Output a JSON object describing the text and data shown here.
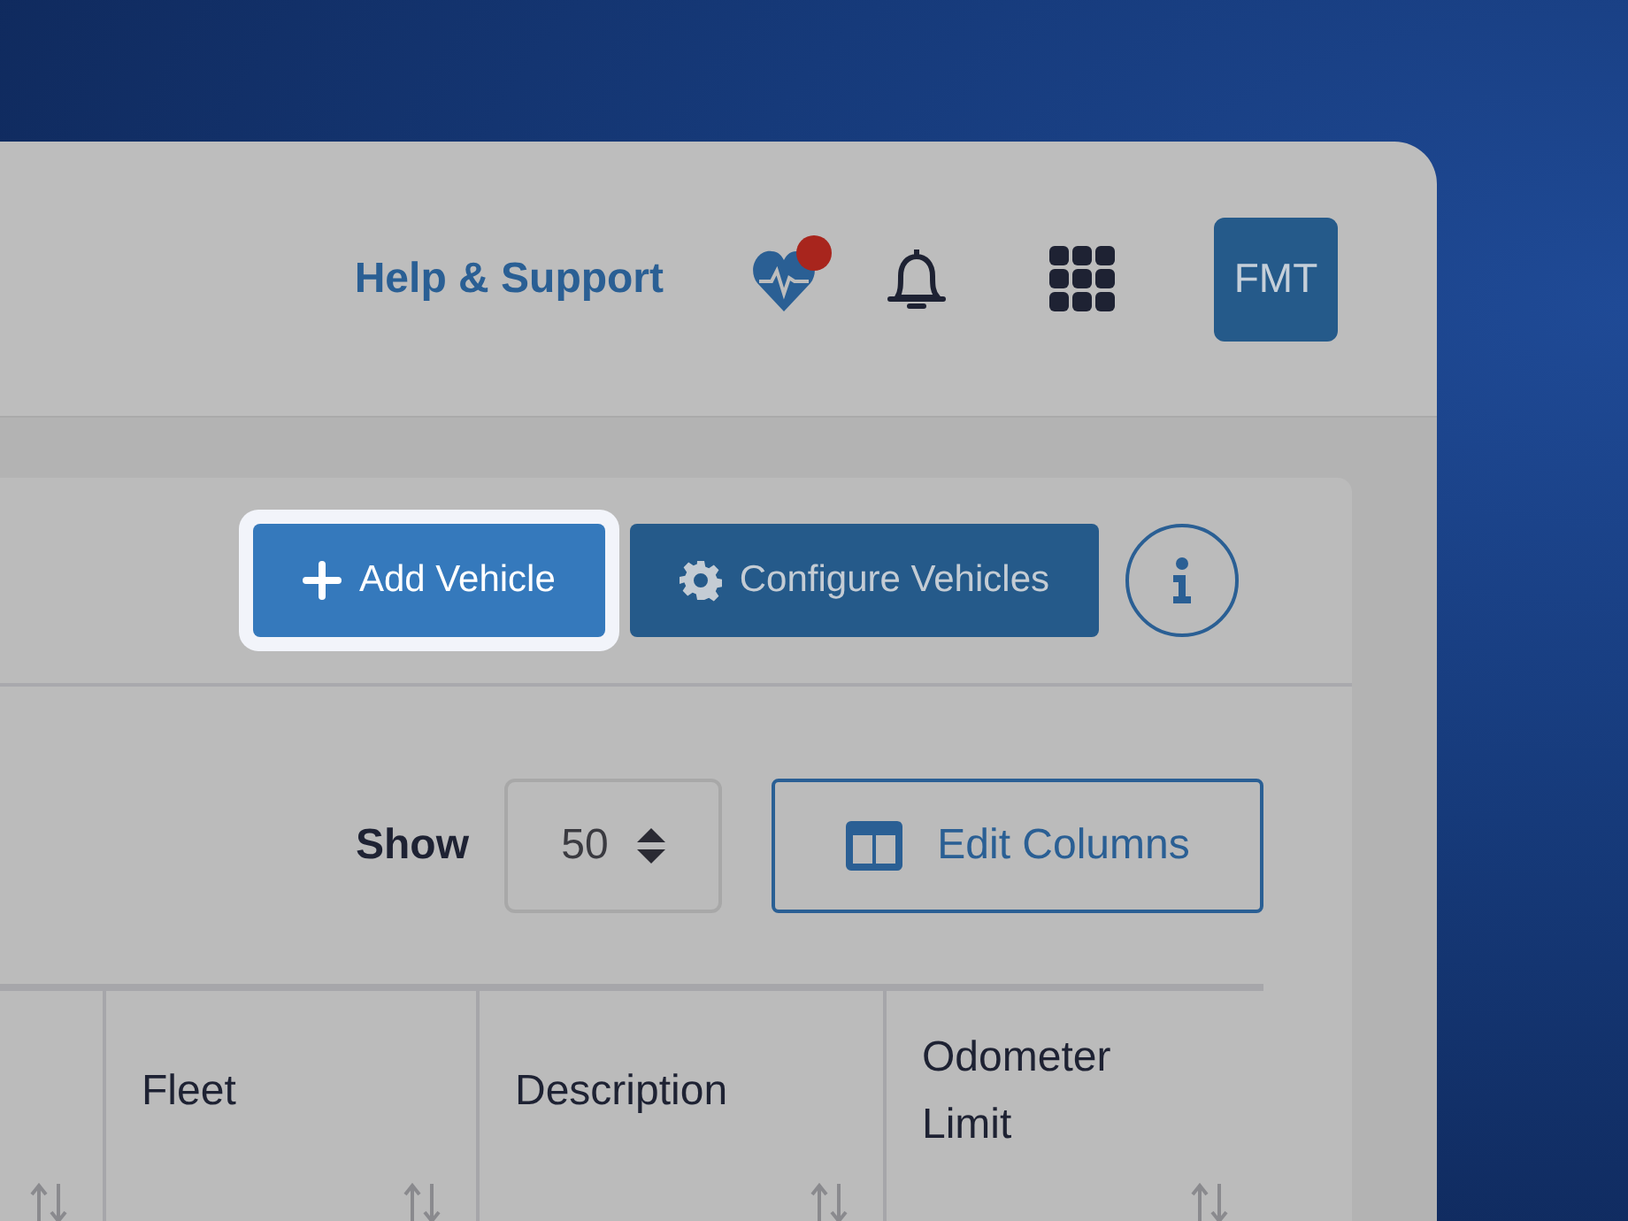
{
  "header": {
    "help_link": "Help & Support",
    "health": {
      "alert": true
    },
    "avatar": {
      "initials": "FMT"
    }
  },
  "toolbar": {
    "buttons": [
      {
        "label": "Add Vehicle",
        "kind": "add",
        "highlighted": true
      },
      {
        "label": "Configure Vehicles",
        "kind": "configure",
        "highlighted": false
      }
    ]
  },
  "controls": {
    "show_label": "Show",
    "page_size": "50",
    "edit_columns": "Edit Columns"
  },
  "table": {
    "columns": [
      {
        "sortable": true
      },
      {
        "label": "Fleet",
        "sortable": true
      },
      {
        "label": "Description",
        "sortable": true
      },
      {
        "label": "Odometer Limit",
        "sortable": true
      }
    ]
  }
}
